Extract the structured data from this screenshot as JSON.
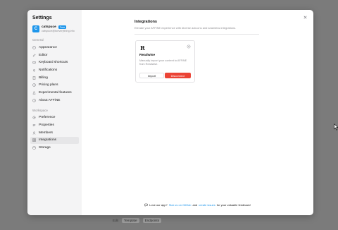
{
  "backdrop": {
    "label": "Edit",
    "pill1": "Template",
    "pill2": "Endpoints"
  },
  "modal": {
    "title": "Settings"
  },
  "account": {
    "avatar_letter": "C",
    "name": "catspuce",
    "badge": "Free",
    "email": "catspuce@toeverything.info"
  },
  "sidebar": {
    "general_label": "General",
    "general_items": [
      {
        "label": "Appearance",
        "icon": "palette-icon"
      },
      {
        "label": "Editor",
        "icon": "pen-icon"
      },
      {
        "label": "Keyboard shortcuts",
        "icon": "keyboard-icon"
      },
      {
        "label": "Notifications",
        "icon": "bell-icon"
      },
      {
        "label": "Billing",
        "icon": "receipt-icon"
      },
      {
        "label": "Pricing plans",
        "icon": "pricing-icon"
      },
      {
        "label": "Experimental features",
        "icon": "flask-icon"
      },
      {
        "label": "About AFFiNE",
        "icon": "info-icon"
      }
    ],
    "workspace_label": "Workspace",
    "workspace_items": [
      {
        "label": "Preference",
        "icon": "preference-icon"
      },
      {
        "label": "Properties",
        "icon": "properties-icon"
      },
      {
        "label": "Members",
        "icon": "members-icon"
      },
      {
        "label": "Integrations",
        "icon": "integrations-icon",
        "active": true
      },
      {
        "label": "Storage",
        "icon": "storage-icon"
      }
    ]
  },
  "integrations": {
    "title": "Integrations",
    "description": "Elevate your AFFiNE experience with diverse add-ons and seamless integrations.",
    "card": {
      "logo": "R",
      "name": "Readwise",
      "description": "Manually import your content to AFFiNE from Readwise.",
      "import_label": "Import",
      "disconnect_label": "Disconnect"
    }
  },
  "footer": {
    "prefix": "Love our app?",
    "star_link": "Star us on GitHub",
    "middle": "and",
    "issue_link": "create issues",
    "suffix": "for your valuable feedback!"
  },
  "colors": {
    "accent": "#1e96eb",
    "danger": "#eb4335"
  }
}
